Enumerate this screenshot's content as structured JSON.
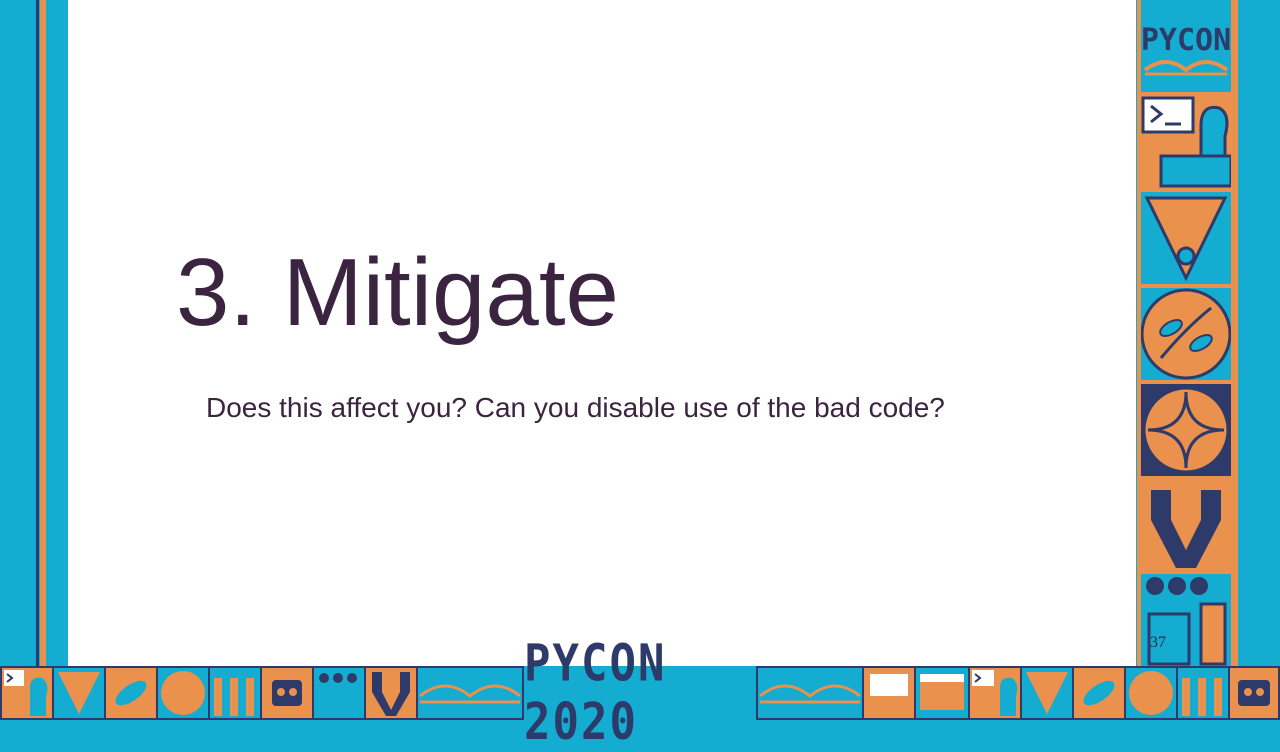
{
  "slide": {
    "title": "3. Mitigate",
    "subtitle": "Does this affect you? Can you disable use of the bad code?",
    "page_number": "37"
  },
  "branding": {
    "side_logo": "PYCON",
    "footer_logo": "PYCON 2020"
  },
  "colors": {
    "background_cyan": "#14acd0",
    "accent_orange": "#e9914d",
    "navy": "#2d3a6a",
    "text_plum": "#3b2440",
    "slide_white": "#ffffff"
  },
  "icons": [
    "terminal-prompt-icon",
    "snake-icon",
    "leaf-icon",
    "robot-icon",
    "bridge-icon",
    "wrench-icon"
  ]
}
